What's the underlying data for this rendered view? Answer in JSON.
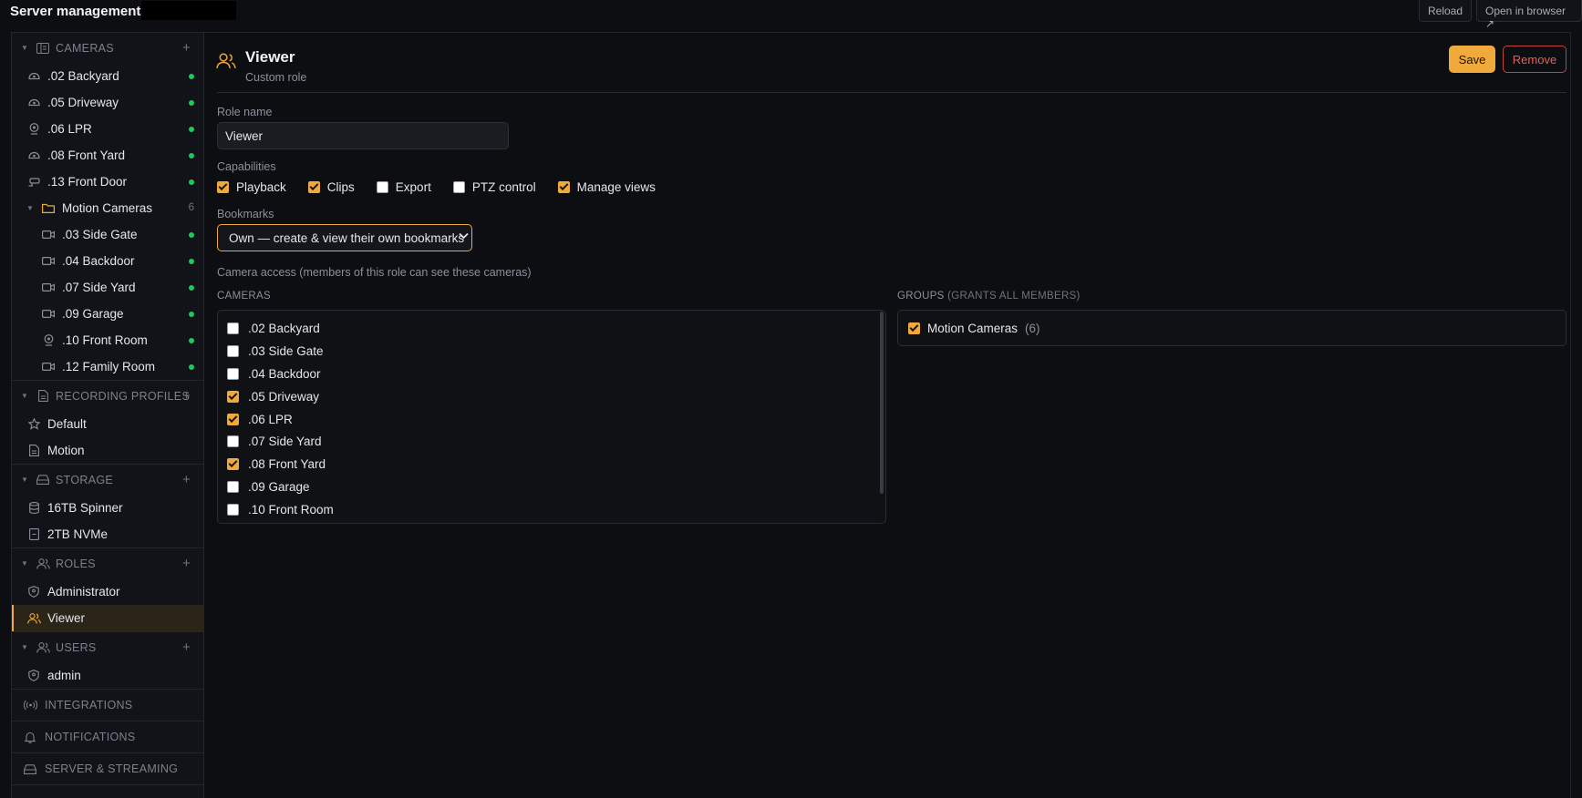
{
  "app": {
    "title": "Server management",
    "reload_label": "Reload",
    "open_browser_label": "Open in browser ↗"
  },
  "sidebar": {
    "cameras": {
      "label": "CAMERAS",
      "items": [
        {
          "label": ".02 Backyard",
          "icon": "dome-camera-icon",
          "status": "online"
        },
        {
          "label": ".05 Driveway",
          "icon": "dome-camera-icon",
          "status": "online"
        },
        {
          "label": ".06 LPR",
          "icon": "webcam-icon",
          "status": "online"
        },
        {
          "label": ".08 Front Yard",
          "icon": "dome-camera-icon",
          "status": "online"
        },
        {
          "label": ".13 Front Door",
          "icon": "bullet-camera-icon",
          "status": "online"
        }
      ],
      "folder": {
        "label": "Motion Cameras",
        "count": "6",
        "items": [
          {
            "label": ".03 Side Gate",
            "icon": "video-camera-icon",
            "status": "online"
          },
          {
            "label": ".04 Backdoor",
            "icon": "video-camera-icon",
            "status": "online"
          },
          {
            "label": ".07 Side Yard",
            "icon": "video-camera-icon",
            "status": "online"
          },
          {
            "label": ".09 Garage",
            "icon": "video-camera-icon",
            "status": "online"
          },
          {
            "label": ".10 Front Room",
            "icon": "webcam-icon",
            "status": "online"
          },
          {
            "label": ".12 Family Room",
            "icon": "video-camera-icon",
            "status": "online"
          }
        ]
      }
    },
    "recording_profiles": {
      "label": "RECORDING PROFILES",
      "items": [
        {
          "label": "Default",
          "icon": "star-icon"
        },
        {
          "label": "Motion",
          "icon": "document-icon"
        }
      ]
    },
    "storage": {
      "label": "STORAGE",
      "items": [
        {
          "label": "16TB Spinner",
          "icon": "database-icon"
        },
        {
          "label": "2TB NVMe",
          "icon": "ssd-icon"
        }
      ]
    },
    "roles": {
      "label": "ROLES",
      "items": [
        {
          "label": "Administrator",
          "icon": "shield-icon"
        },
        {
          "label": "Viewer",
          "icon": "users-icon",
          "active": true
        }
      ]
    },
    "users": {
      "label": "USERS",
      "items": [
        {
          "label": "admin",
          "icon": "shield-icon"
        }
      ]
    },
    "integrations_label": "INTEGRATIONS",
    "notifications_label": "NOTIFICATIONS",
    "server_streaming_label": "SERVER & STREAMING"
  },
  "role": {
    "title": "Viewer",
    "subtitle": "Custom role",
    "save_label": "Save",
    "remove_label": "Remove",
    "role_name_label": "Role name",
    "role_name_value": "Viewer",
    "capabilities_label": "Capabilities",
    "capabilities": [
      {
        "label": "Playback",
        "checked": true
      },
      {
        "label": "Clips",
        "checked": true
      },
      {
        "label": "Export",
        "checked": false
      },
      {
        "label": "PTZ control",
        "checked": false
      },
      {
        "label": "Manage views",
        "checked": true
      }
    ],
    "bookmarks_label": "Bookmarks",
    "bookmarks_value": "Own — create & view their own bookmarks",
    "camera_access_label": "Camera access (members of this role can see these cameras)",
    "cameras_col_label": "CAMERAS",
    "groups_col_label": "GROUPS",
    "groups_col_note": "(GRANTS ALL MEMBERS)",
    "cameras": [
      {
        "label": ".02 Backyard",
        "checked": false
      },
      {
        "label": ".03 Side Gate",
        "checked": false
      },
      {
        "label": ".04 Backdoor",
        "checked": false
      },
      {
        "label": ".05 Driveway",
        "checked": true
      },
      {
        "label": ".06 LPR",
        "checked": true
      },
      {
        "label": ".07 Side Yard",
        "checked": false
      },
      {
        "label": ".08 Front Yard",
        "checked": true
      },
      {
        "label": ".09 Garage",
        "checked": false
      },
      {
        "label": ".10 Front Room",
        "checked": false
      }
    ],
    "groups": [
      {
        "label": "Motion Cameras",
        "count": "(6)",
        "checked": true
      }
    ]
  },
  "colors": {
    "accent": "#f0a93b",
    "online": "#22c55e",
    "danger": "#e0625c"
  }
}
